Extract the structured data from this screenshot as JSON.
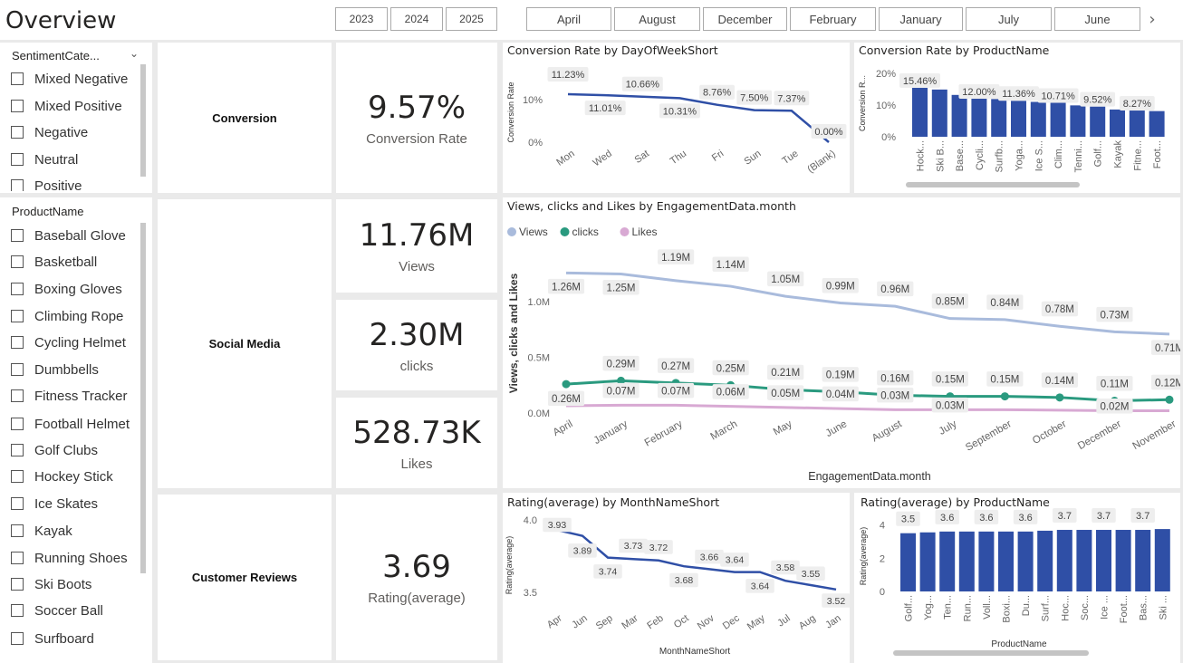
{
  "page_title": "Overview",
  "year_buttons": [
    "2023",
    "2024",
    "2025"
  ],
  "month_buttons": [
    "April",
    "August",
    "December",
    "February",
    "January",
    "July",
    "June"
  ],
  "sentiment_slicer": {
    "title": "SentimentCate...",
    "items": [
      "Mixed Negative",
      "Mixed Positive",
      "Negative",
      "Neutral",
      "Positive"
    ]
  },
  "product_slicer": {
    "title": "ProductName",
    "items": [
      "Baseball Glove",
      "Basketball",
      "Boxing Gloves",
      "Climbing Rope",
      "Cycling Helmet",
      "Dumbbells",
      "Fitness Tracker",
      "Football Helmet",
      "Golf Clubs",
      "Hockey Stick",
      "Ice Skates",
      "Kayak",
      "Running Shoes",
      "Ski Boots",
      "Soccer Ball",
      "Surfboard"
    ]
  },
  "sections": {
    "conversion": "Conversion",
    "social": "Social Media",
    "reviews": "Customer Reviews"
  },
  "kpis": {
    "conversion": {
      "value": "9.57%",
      "label": "Conversion Rate"
    },
    "views": {
      "value": "11.76M",
      "label": "Views"
    },
    "clicks": {
      "value": "2.30M",
      "label": "clicks"
    },
    "likes": {
      "value": "528.73K",
      "label": "Likes"
    },
    "rating": {
      "value": "3.69",
      "label": "Rating(average)"
    }
  },
  "colors": {
    "primary": "#2f4fa6",
    "views": "#a9bbdc",
    "clicks": "#2a9a7f",
    "likes": "#d8a9d3"
  },
  "chart_data": [
    {
      "id": "conv_dow",
      "type": "line",
      "title": "Conversion Rate by DayOfWeekShort",
      "ylabel": "Conversion Rate",
      "xlabel": "",
      "categories": [
        "Mon",
        "Wed",
        "Sat",
        "Thu",
        "Fri",
        "Sun",
        "Tue",
        "(Blank)"
      ],
      "values": [
        11.23,
        11.01,
        10.66,
        10.31,
        8.76,
        7.5,
        7.37,
        0.0
      ],
      "labels": [
        "11.23%",
        "11.01%",
        "10.66%",
        "10.31%",
        "8.76%",
        "7.50%",
        "7.37%",
        "0.00%"
      ],
      "yticks": [
        "10%",
        "0%"
      ],
      "ylim": [
        0,
        14
      ]
    },
    {
      "id": "conv_prod",
      "type": "bar",
      "title": "Conversion Rate by ProductName",
      "ylabel": "Conversion R...",
      "xlabel": "",
      "categories": [
        "Hock...",
        "Ski B...",
        "Base...",
        "Cycli...",
        "Surfb...",
        "Yoga...",
        "Ice S...",
        "Clim...",
        "Tenni...",
        "Golf...",
        "Kayak",
        "Fitne...",
        "Foot..."
      ],
      "values": [
        15.46,
        14.9,
        13.2,
        12.0,
        11.9,
        11.36,
        11.0,
        10.71,
        9.9,
        9.52,
        8.6,
        8.27,
        8.1
      ],
      "labels": [
        "15.46%",
        "",
        "",
        "12.00%",
        "",
        "11.36%",
        "",
        "10.71%",
        "",
        "9.52%",
        "",
        "8.27%",
        ""
      ],
      "yticks": [
        "20%",
        "10%",
        "0%"
      ],
      "ylim": [
        0,
        20
      ]
    },
    {
      "id": "engagement",
      "type": "line",
      "title": "Views, clicks and Likes by EngagementData.month",
      "ylabel": "Views, clicks and Likes",
      "xlabel": "EngagementData.month",
      "categories": [
        "April",
        "January",
        "February",
        "March",
        "May",
        "June",
        "August",
        "July",
        "September",
        "October",
        "December",
        "November"
      ],
      "series": [
        {
          "name": "Views",
          "values": [
            1.26,
            1.25,
            1.19,
            1.14,
            1.05,
            0.99,
            0.96,
            0.85,
            0.84,
            0.78,
            0.73,
            0.71
          ],
          "labels": [
            "1.26M",
            "1.25M",
            "1.19M",
            "1.14M",
            "1.05M",
            "0.99M",
            "0.96M",
            "0.85M",
            "0.84M",
            "0.78M",
            "0.73M",
            "0.71M"
          ]
        },
        {
          "name": "clicks",
          "values": [
            0.26,
            0.29,
            0.27,
            0.25,
            0.21,
            0.19,
            0.16,
            0.15,
            0.15,
            0.14,
            0.11,
            0.12
          ],
          "labels": [
            "0.26M",
            "0.29M",
            "0.27M",
            "0.25M",
            "0.21M",
            "0.19M",
            "0.16M",
            "0.15M",
            "0.15M",
            "0.14M",
            "0.11M",
            "0.12M"
          ]
        },
        {
          "name": "Likes",
          "values": [
            0.065,
            0.07,
            0.07,
            0.06,
            0.05,
            0.04,
            0.03,
            0.03,
            0.03,
            0.025,
            0.02,
            0.02
          ],
          "labels": [
            "",
            "0.07M",
            "0.07M",
            "0.06M",
            "0.05M",
            "0.04M",
            "0.03M",
            "0.03M",
            "",
            "",
            "0.02M",
            ""
          ]
        }
      ],
      "yticks": [
        "1.0M",
        "0.5M",
        "0.0M"
      ],
      "ylim": [
        0,
        1.45
      ],
      "legend": "top-left"
    },
    {
      "id": "rating_month",
      "type": "line",
      "title": "Rating(average) by MonthNameShort",
      "ylabel": "Rating(average)",
      "xlabel": "MonthNameShort",
      "categories": [
        "Apr",
        "Jun",
        "Sep",
        "Mar",
        "Feb",
        "Oct",
        "Nov",
        "Dec",
        "May",
        "Jul",
        "Aug",
        "Jan"
      ],
      "values": [
        3.93,
        3.89,
        3.74,
        3.73,
        3.72,
        3.68,
        3.66,
        3.64,
        3.64,
        3.58,
        3.55,
        3.52
      ],
      "labels": [
        "3.93",
        "3.89",
        "3.74",
        "3.73",
        "3.72",
        "3.68",
        "3.66",
        "3.64",
        "3.64",
        "3.58",
        "3.55",
        "3.52"
      ],
      "yticks": [
        "4.0",
        "3.5"
      ],
      "ylim": [
        3.45,
        4.0
      ]
    },
    {
      "id": "rating_prod",
      "type": "bar",
      "title": "Rating(average) by ProductName",
      "ylabel": "Rating(average)",
      "xlabel": "ProductName",
      "categories": [
        "Golf...",
        "Yog...",
        "Ten...",
        "Run...",
        "Voll...",
        "Boxi...",
        "Du...",
        "Surf...",
        "Hoc...",
        "Soc...",
        "Ice ...",
        "Foot...",
        "Bas...",
        "Ski ..."
      ],
      "values": [
        3.5,
        3.55,
        3.6,
        3.6,
        3.6,
        3.6,
        3.6,
        3.65,
        3.7,
        3.7,
        3.7,
        3.7,
        3.7,
        3.75
      ],
      "labels": [
        "3.5",
        "",
        "3.6",
        "",
        "3.6",
        "",
        "3.6",
        "",
        "3.7",
        "",
        "3.7",
        "",
        "3.7",
        ""
      ],
      "yticks": [
        "4",
        "2",
        "0"
      ],
      "ylim": [
        0,
        4.3
      ]
    }
  ]
}
